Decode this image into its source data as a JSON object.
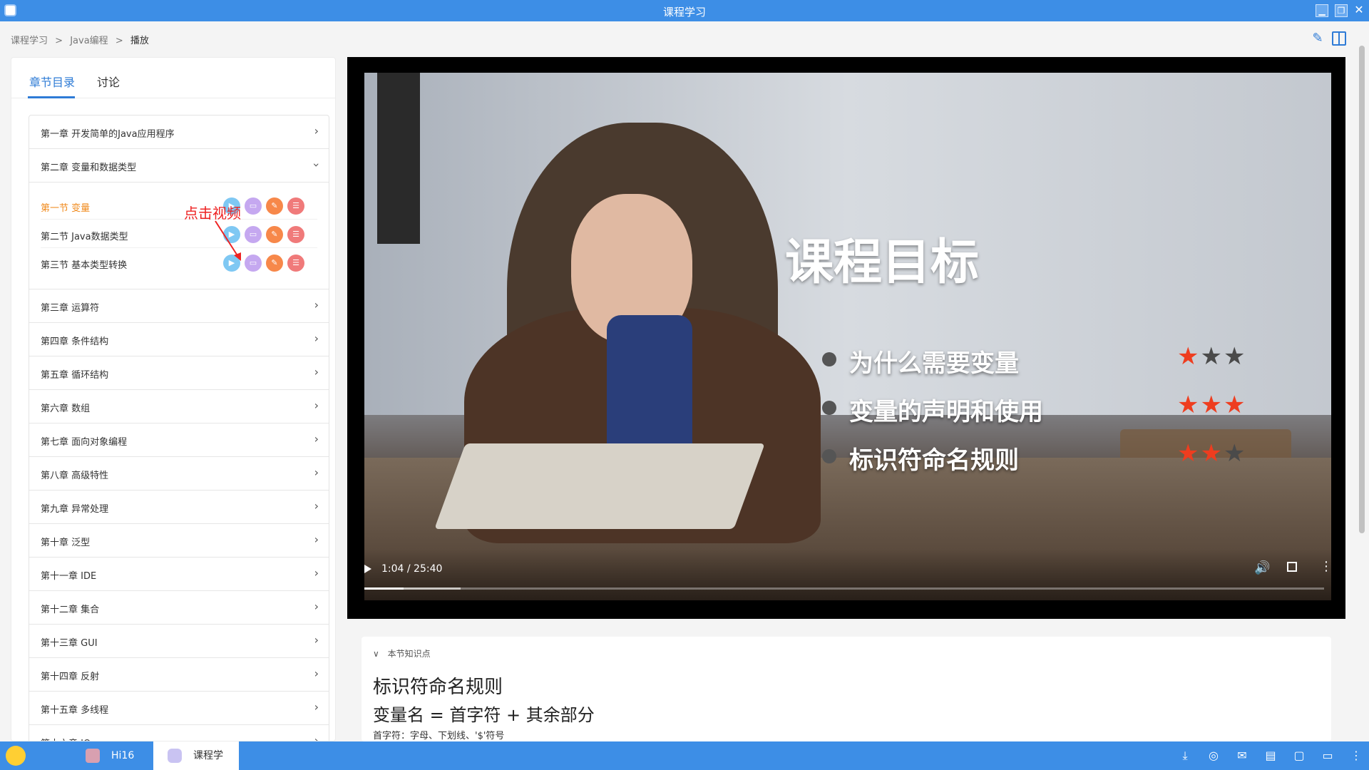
{
  "window": {
    "title": "课程学习"
  },
  "breadcrumb": [
    "课程学习",
    ">",
    "Java编程",
    ">",
    "播放"
  ],
  "tabs": {
    "catalog": "章节目录",
    "discussion": "讨论"
  },
  "annotation": "点击视频",
  "chapters_top": [
    {
      "label": "第一章 开发简单的Java应用程序",
      "state": "collapsed"
    },
    {
      "label": "第二章 变量和数据类型",
      "state": "expanded"
    }
  ],
  "sections": [
    {
      "label": "第一节 变量",
      "active": true
    },
    {
      "label": "第二节 Java数据类型",
      "active": false
    },
    {
      "label": "第三节 基本类型转换",
      "active": false
    }
  ],
  "chapters_rest": [
    "第三章 运算符",
    "第四章 条件结构",
    "第五章 循环结构",
    "第六章 数组",
    "第七章 面向对象编程",
    "第八章 高级特性",
    "第九章 异常处理",
    "第十章 泛型",
    "第十一章 IDE",
    "第十二章 集合",
    "第十三章 GUI",
    "第十四章 反射",
    "第十五章 多线程",
    "第十六章 IO"
  ],
  "video": {
    "slide_title": "课程目标",
    "goals": [
      {
        "text": "为什么需要变量",
        "stars": 1
      },
      {
        "text": "变量的声明和使用",
        "stars": 3
      },
      {
        "text": "标识符命名规则",
        "stars": 2
      }
    ],
    "max_stars": 3,
    "time": "1:04 / 25:40",
    "progress": 0.041
  },
  "knowledge": {
    "header": "本节知识点",
    "title": "标识符命名规则",
    "formula": "变量名 = 首字符 + 其余部分",
    "note": "首字符：字母、下划线、'$'符号"
  },
  "taskbar": {
    "tasks": [
      {
        "label": "Hi16"
      },
      {
        "label": "课程学"
      }
    ]
  },
  "colors": {
    "accent": "#2e7bd6",
    "titlebar": "#3d8ee6",
    "active_section": "#f08a1c",
    "star_on": "#ee3d1f",
    "annotation": "#e22222"
  }
}
